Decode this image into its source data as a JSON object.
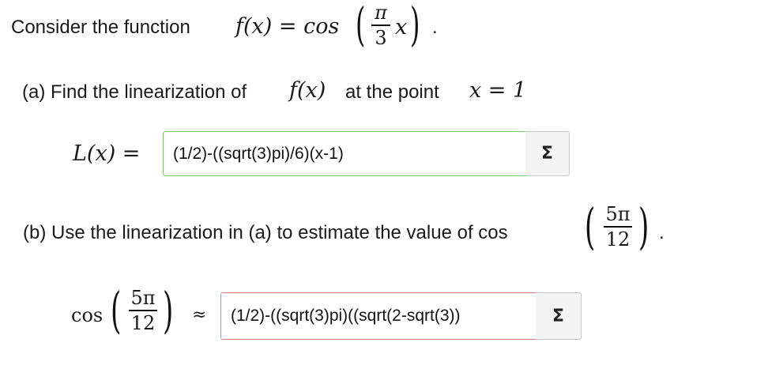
{
  "intro": {
    "text": "Consider the function",
    "func_lhs": "f(x) = cos",
    "frac_num": "π",
    "frac_den": "3",
    "var": "x",
    "end": "."
  },
  "part_a": {
    "text": "(a) Find the linearization of",
    "func": "f(x)",
    "at_text": "at the point",
    "point": "x = 1",
    "label": "L(x) =",
    "answer": "(1/2)-((sqrt(3)pi)/6)(x-1)",
    "answer_status": "correct",
    "sigma": "Σ"
  },
  "part_b": {
    "text": "(b) Use the linearization in (a) to estimate the value of cos",
    "frac_num": "5π",
    "frac_den": "12",
    "end": ".",
    "lhs_cos": "cos",
    "approx": "≈",
    "answer": "(1/2)-((sqrt(3)pi)((sqrt(2-sqrt(3))",
    "answer_status": "incorrect",
    "sigma": "Σ"
  },
  "colors": {
    "correct_border": "#7cc36a",
    "incorrect_border": "#e07b7b"
  }
}
